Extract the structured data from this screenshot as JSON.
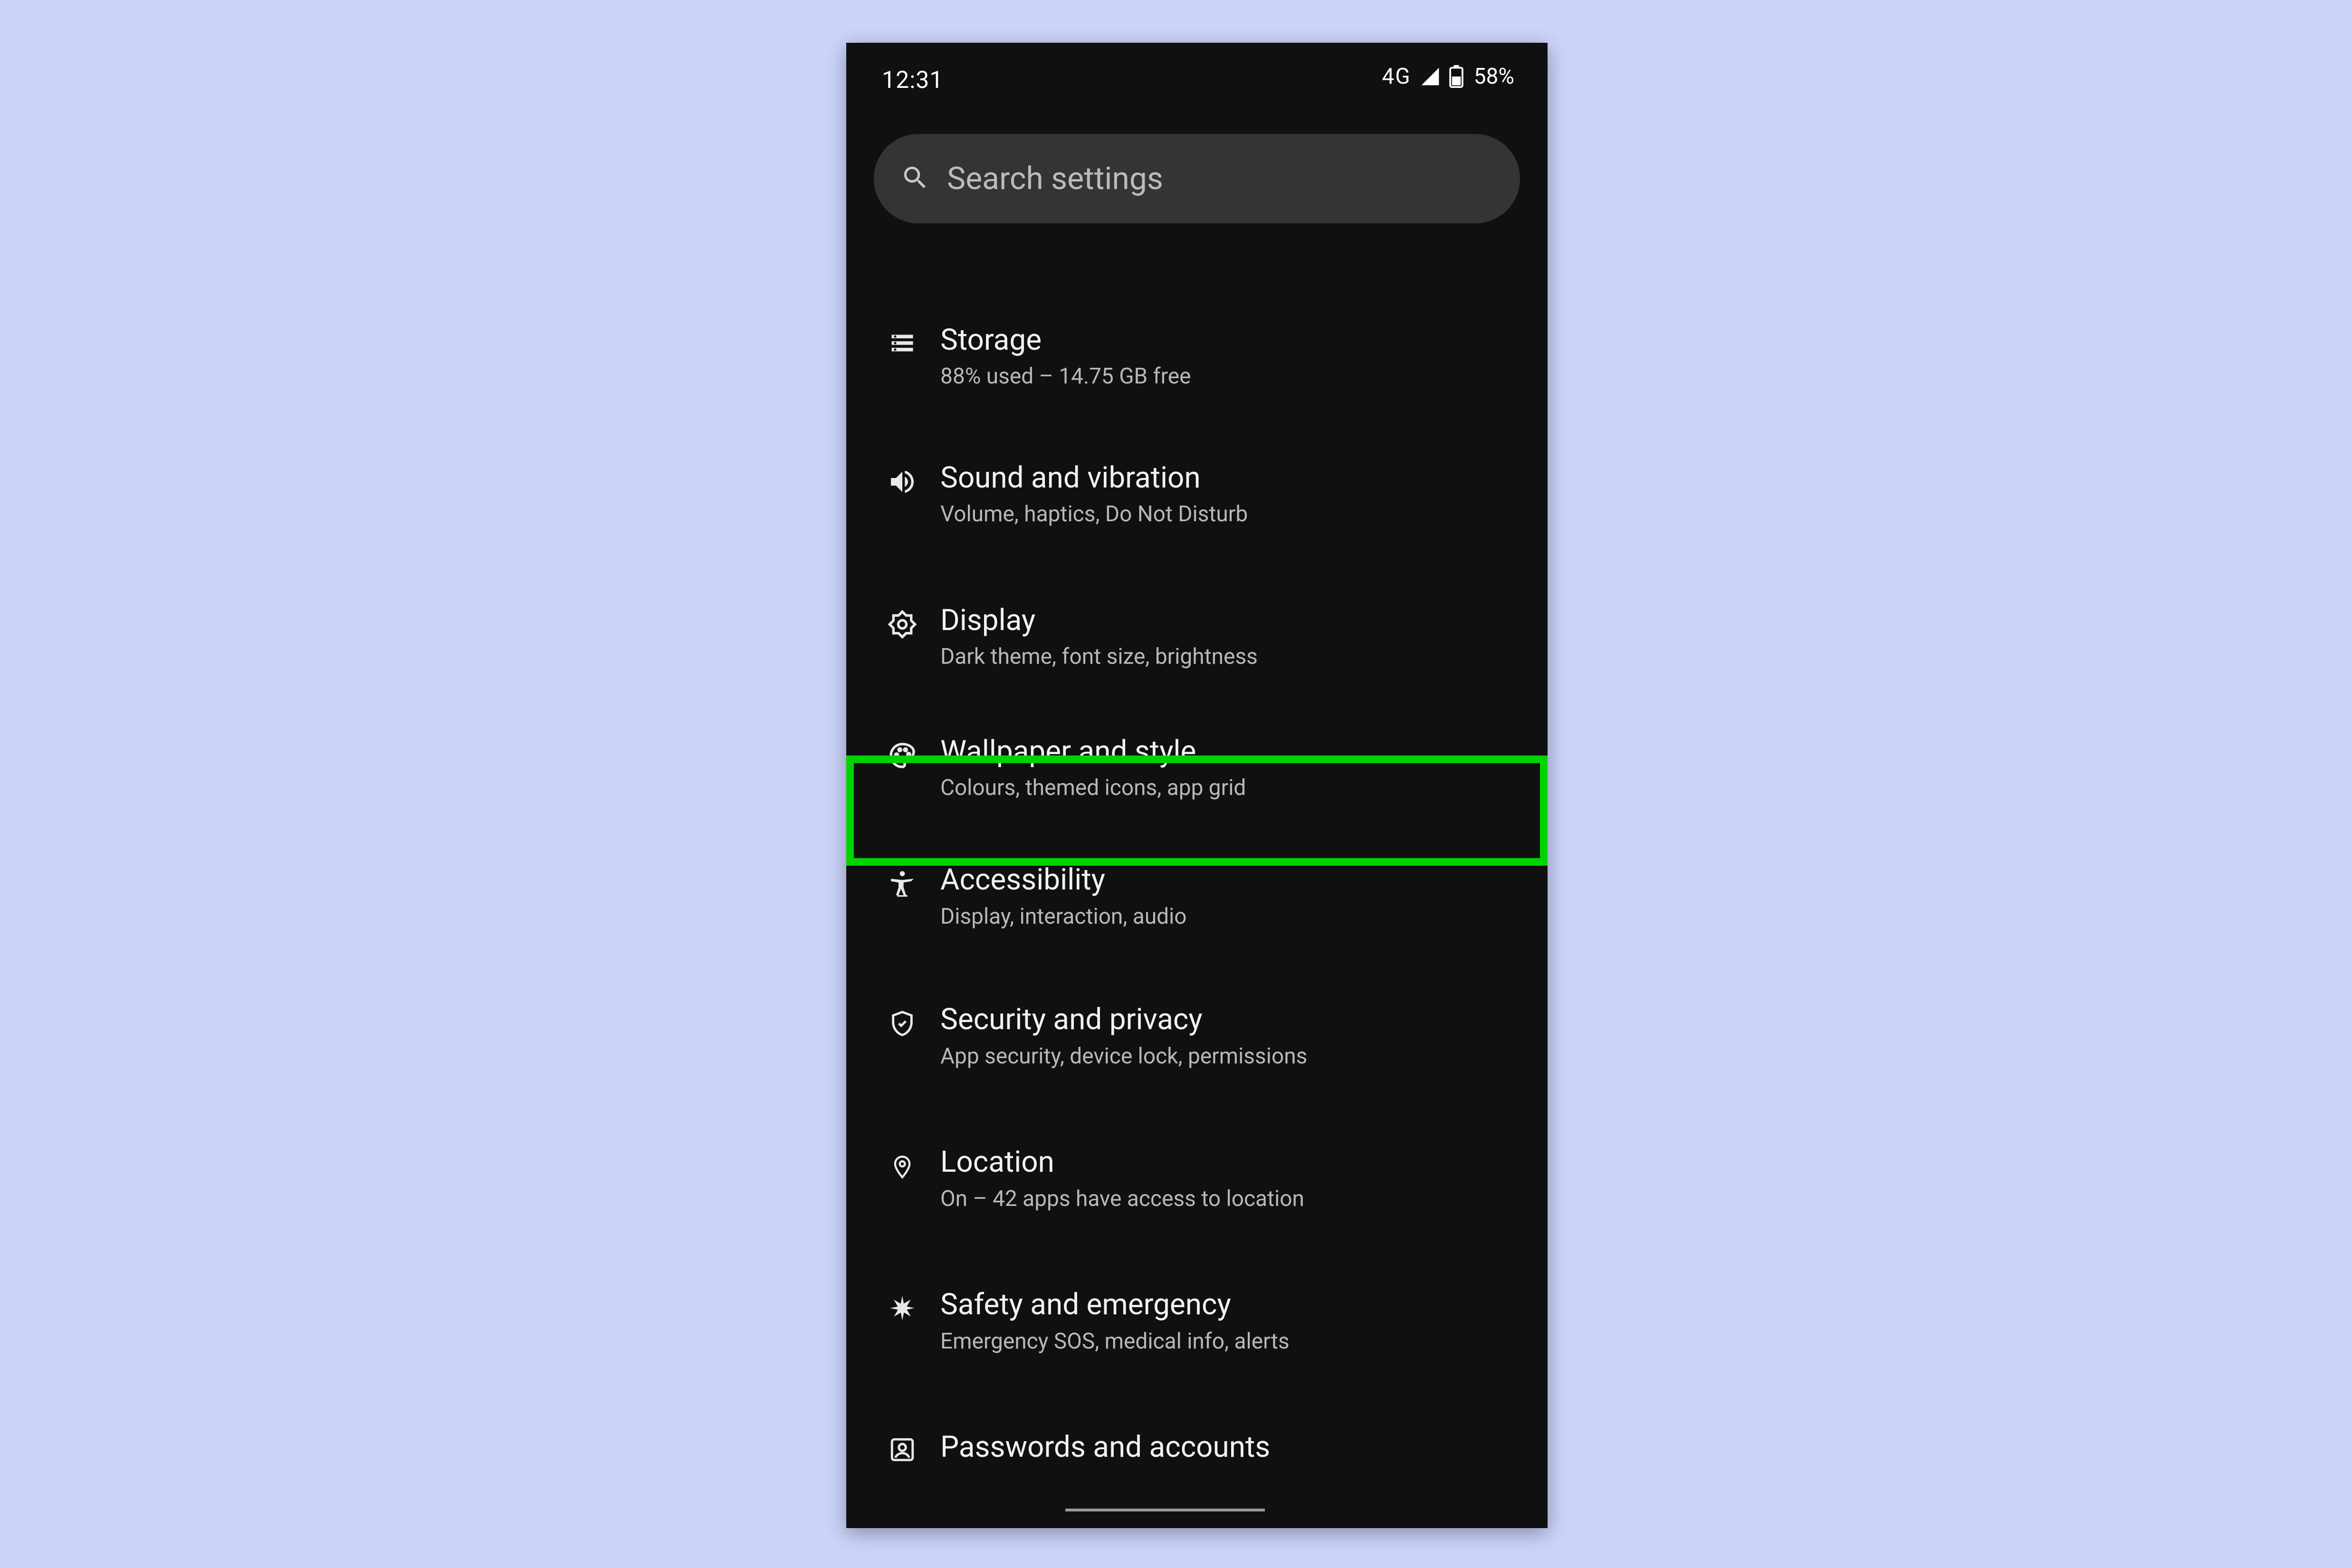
{
  "status": {
    "time": "12:31",
    "network": "4G",
    "battery_pct": "58%"
  },
  "search": {
    "placeholder": "Search settings"
  },
  "items": [
    {
      "icon": "storage",
      "title": "Storage",
      "sub": "88% used – 14.75 GB free"
    },
    {
      "icon": "sound",
      "title": "Sound and vibration",
      "sub": "Volume, haptics, Do Not Disturb"
    },
    {
      "icon": "display",
      "title": "Display",
      "sub": "Dark theme, font size, brightness"
    },
    {
      "icon": "palette",
      "title": "Wallpaper and style",
      "sub": "Colours, themed icons, app grid",
      "highlight": true
    },
    {
      "icon": "accessibility",
      "title": "Accessibility",
      "sub": "Display, interaction, audio"
    },
    {
      "icon": "shield",
      "title": "Security and privacy",
      "sub": "App security, device lock, permissions"
    },
    {
      "icon": "location",
      "title": "Location",
      "sub": "On – 42 apps have access to location"
    },
    {
      "icon": "asterisk",
      "title": "Safety and emergency",
      "sub": "Emergency SOS, medical info, alerts"
    },
    {
      "icon": "account",
      "title": "Passwords and accounts",
      "sub": ""
    }
  ],
  "highlight_color": "#00d400"
}
